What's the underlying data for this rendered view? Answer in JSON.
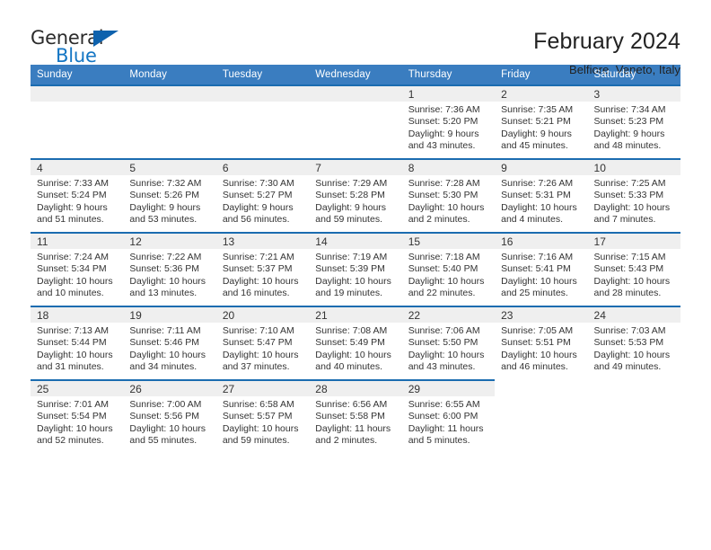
{
  "brand": {
    "name_part1": "General",
    "name_part2": "Blue",
    "triangle_color": "#0e62ad",
    "blue_color": "#1476c4"
  },
  "header": {
    "month_title": "February 2024",
    "location": "Belfiore, Veneto, Italy"
  },
  "theme": {
    "header_row_bg": "#3a7dc0",
    "cell_top_border": "#1b6cb0",
    "daynum_band_bg": "#efefef"
  },
  "weekday_headers": [
    "Sunday",
    "Monday",
    "Tuesday",
    "Wednesday",
    "Thursday",
    "Friday",
    "Saturday"
  ],
  "calendar_cells": [
    {
      "day": "",
      "sunrise": "",
      "sunset": "",
      "daylight_line1": "",
      "daylight_line2": "",
      "empty": true
    },
    {
      "day": "",
      "sunrise": "",
      "sunset": "",
      "daylight_line1": "",
      "daylight_line2": "",
      "empty": true
    },
    {
      "day": "",
      "sunrise": "",
      "sunset": "",
      "daylight_line1": "",
      "daylight_line2": "",
      "empty": true
    },
    {
      "day": "",
      "sunrise": "",
      "sunset": "",
      "daylight_line1": "",
      "daylight_line2": "",
      "empty": true
    },
    {
      "day": "1",
      "sunrise": "Sunrise: 7:36 AM",
      "sunset": "Sunset: 5:20 PM",
      "daylight_line1": "Daylight: 9 hours",
      "daylight_line2": "and 43 minutes."
    },
    {
      "day": "2",
      "sunrise": "Sunrise: 7:35 AM",
      "sunset": "Sunset: 5:21 PM",
      "daylight_line1": "Daylight: 9 hours",
      "daylight_line2": "and 45 minutes."
    },
    {
      "day": "3",
      "sunrise": "Sunrise: 7:34 AM",
      "sunset": "Sunset: 5:23 PM",
      "daylight_line1": "Daylight: 9 hours",
      "daylight_line2": "and 48 minutes."
    },
    {
      "day": "4",
      "sunrise": "Sunrise: 7:33 AM",
      "sunset": "Sunset: 5:24 PM",
      "daylight_line1": "Daylight: 9 hours",
      "daylight_line2": "and 51 minutes."
    },
    {
      "day": "5",
      "sunrise": "Sunrise: 7:32 AM",
      "sunset": "Sunset: 5:26 PM",
      "daylight_line1": "Daylight: 9 hours",
      "daylight_line2": "and 53 minutes."
    },
    {
      "day": "6",
      "sunrise": "Sunrise: 7:30 AM",
      "sunset": "Sunset: 5:27 PM",
      "daylight_line1": "Daylight: 9 hours",
      "daylight_line2": "and 56 minutes."
    },
    {
      "day": "7",
      "sunrise": "Sunrise: 7:29 AM",
      "sunset": "Sunset: 5:28 PM",
      "daylight_line1": "Daylight: 9 hours",
      "daylight_line2": "and 59 minutes."
    },
    {
      "day": "8",
      "sunrise": "Sunrise: 7:28 AM",
      "sunset": "Sunset: 5:30 PM",
      "daylight_line1": "Daylight: 10 hours",
      "daylight_line2": "and 2 minutes."
    },
    {
      "day": "9",
      "sunrise": "Sunrise: 7:26 AM",
      "sunset": "Sunset: 5:31 PM",
      "daylight_line1": "Daylight: 10 hours",
      "daylight_line2": "and 4 minutes."
    },
    {
      "day": "10",
      "sunrise": "Sunrise: 7:25 AM",
      "sunset": "Sunset: 5:33 PM",
      "daylight_line1": "Daylight: 10 hours",
      "daylight_line2": "and 7 minutes."
    },
    {
      "day": "11",
      "sunrise": "Sunrise: 7:24 AM",
      "sunset": "Sunset: 5:34 PM",
      "daylight_line1": "Daylight: 10 hours",
      "daylight_line2": "and 10 minutes."
    },
    {
      "day": "12",
      "sunrise": "Sunrise: 7:22 AM",
      "sunset": "Sunset: 5:36 PM",
      "daylight_line1": "Daylight: 10 hours",
      "daylight_line2": "and 13 minutes."
    },
    {
      "day": "13",
      "sunrise": "Sunrise: 7:21 AM",
      "sunset": "Sunset: 5:37 PM",
      "daylight_line1": "Daylight: 10 hours",
      "daylight_line2": "and 16 minutes."
    },
    {
      "day": "14",
      "sunrise": "Sunrise: 7:19 AM",
      "sunset": "Sunset: 5:39 PM",
      "daylight_line1": "Daylight: 10 hours",
      "daylight_line2": "and 19 minutes."
    },
    {
      "day": "15",
      "sunrise": "Sunrise: 7:18 AM",
      "sunset": "Sunset: 5:40 PM",
      "daylight_line1": "Daylight: 10 hours",
      "daylight_line2": "and 22 minutes."
    },
    {
      "day": "16",
      "sunrise": "Sunrise: 7:16 AM",
      "sunset": "Sunset: 5:41 PM",
      "daylight_line1": "Daylight: 10 hours",
      "daylight_line2": "and 25 minutes."
    },
    {
      "day": "17",
      "sunrise": "Sunrise: 7:15 AM",
      "sunset": "Sunset: 5:43 PM",
      "daylight_line1": "Daylight: 10 hours",
      "daylight_line2": "and 28 minutes."
    },
    {
      "day": "18",
      "sunrise": "Sunrise: 7:13 AM",
      "sunset": "Sunset: 5:44 PM",
      "daylight_line1": "Daylight: 10 hours",
      "daylight_line2": "and 31 minutes."
    },
    {
      "day": "19",
      "sunrise": "Sunrise: 7:11 AM",
      "sunset": "Sunset: 5:46 PM",
      "daylight_line1": "Daylight: 10 hours",
      "daylight_line2": "and 34 minutes."
    },
    {
      "day": "20",
      "sunrise": "Sunrise: 7:10 AM",
      "sunset": "Sunset: 5:47 PM",
      "daylight_line1": "Daylight: 10 hours",
      "daylight_line2": "and 37 minutes."
    },
    {
      "day": "21",
      "sunrise": "Sunrise: 7:08 AM",
      "sunset": "Sunset: 5:49 PM",
      "daylight_line1": "Daylight: 10 hours",
      "daylight_line2": "and 40 minutes."
    },
    {
      "day": "22",
      "sunrise": "Sunrise: 7:06 AM",
      "sunset": "Sunset: 5:50 PM",
      "daylight_line1": "Daylight: 10 hours",
      "daylight_line2": "and 43 minutes."
    },
    {
      "day": "23",
      "sunrise": "Sunrise: 7:05 AM",
      "sunset": "Sunset: 5:51 PM",
      "daylight_line1": "Daylight: 10 hours",
      "daylight_line2": "and 46 minutes."
    },
    {
      "day": "24",
      "sunrise": "Sunrise: 7:03 AM",
      "sunset": "Sunset: 5:53 PM",
      "daylight_line1": "Daylight: 10 hours",
      "daylight_line2": "and 49 minutes."
    },
    {
      "day": "25",
      "sunrise": "Sunrise: 7:01 AM",
      "sunset": "Sunset: 5:54 PM",
      "daylight_line1": "Daylight: 10 hours",
      "daylight_line2": "and 52 minutes."
    },
    {
      "day": "26",
      "sunrise": "Sunrise: 7:00 AM",
      "sunset": "Sunset: 5:56 PM",
      "daylight_line1": "Daylight: 10 hours",
      "daylight_line2": "and 55 minutes."
    },
    {
      "day": "27",
      "sunrise": "Sunrise: 6:58 AM",
      "sunset": "Sunset: 5:57 PM",
      "daylight_line1": "Daylight: 10 hours",
      "daylight_line2": "and 59 minutes."
    },
    {
      "day": "28",
      "sunrise": "Sunrise: 6:56 AM",
      "sunset": "Sunset: 5:58 PM",
      "daylight_line1": "Daylight: 11 hours",
      "daylight_line2": "and 2 minutes."
    },
    {
      "day": "29",
      "sunrise": "Sunrise: 6:55 AM",
      "sunset": "Sunset: 6:00 PM",
      "daylight_line1": "Daylight: 11 hours",
      "daylight_line2": "and 5 minutes."
    },
    {
      "day": "",
      "sunrise": "",
      "sunset": "",
      "daylight_line1": "",
      "daylight_line2": "",
      "empty": true,
      "blank": true
    },
    {
      "day": "",
      "sunrise": "",
      "sunset": "",
      "daylight_line1": "",
      "daylight_line2": "",
      "empty": true,
      "blank": true
    }
  ]
}
